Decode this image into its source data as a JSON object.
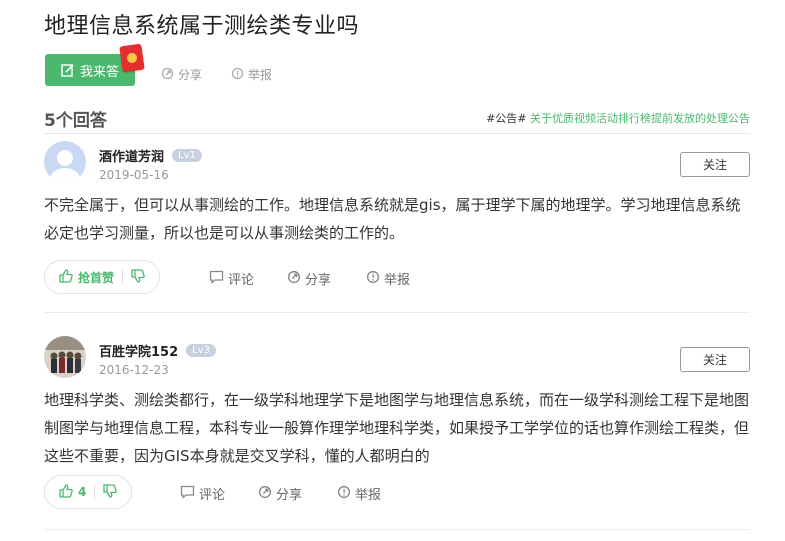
{
  "question": {
    "title": "地理信息系统属于测绘类专业吗"
  },
  "toolbar": {
    "answer_label": "我来答",
    "share_label": "分享",
    "report_label": "举报"
  },
  "answers_header": {
    "count_label": "5个回答",
    "notice_tag": "#公告#",
    "notice_text": "关于优质视频活动排行榜提前发放的处理公告"
  },
  "answers": [
    {
      "author": "酒作道芳润",
      "level": "Lv1",
      "date": "2019-05-16",
      "follow_label": "关注",
      "content": "不完全属于，但可以从事测绘的工作。地理信息系统就是gis，属于理学下属的地理学。学习地理信息系统必定也学习测量，所以也是可以从事测绘类的工作的。",
      "vote_label": "抢首赞",
      "comment_label": "评论",
      "share_label": "分享",
      "report_label": "举报"
    },
    {
      "author": "百胜学院152",
      "level": "Lv3",
      "date": "2016-12-23",
      "follow_label": "关注",
      "content": "地理科学类、测绘类都行，在一级学科地理学下是地图学与地理信息系统，而在一级学科测绘工程下是地图制图学与地理信息工程，本科专业一般算作理学地理科学类，如果授予工学学位的话也算作测绘工程类，但这些不重要，因为GIS本身就是交叉学科，懂的人都明白的",
      "vote_label": "4",
      "comment_label": "评论",
      "share_label": "分享",
      "report_label": "举报"
    }
  ],
  "colors": {
    "accent": "#4cb86e",
    "muted": "#999999",
    "text": "#333333"
  }
}
